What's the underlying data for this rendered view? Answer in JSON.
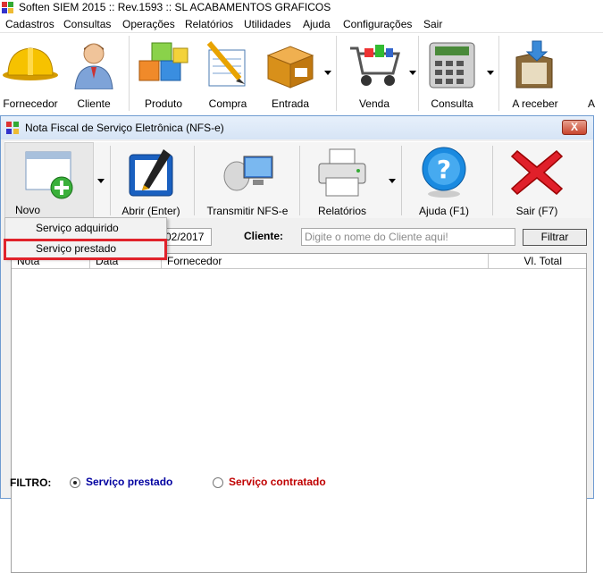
{
  "app": {
    "title": "Soften SIEM 2015 :: Rev.1593 :: SL ACABAMENTOS GRAFICOS"
  },
  "menubar": {
    "items": [
      "Cadastros",
      "Consultas",
      "Operações",
      "Relatórios",
      "Utilidades",
      "Ajuda",
      "Configurações",
      "Sair"
    ]
  },
  "main_toolbar": {
    "buttons": [
      "Fornecedor",
      "Cliente",
      "Produto",
      "Compra",
      "Entrada",
      "Venda",
      "Consulta",
      "A receber",
      "A"
    ]
  },
  "nfse_window": {
    "title": "Nota Fiscal de Serviço Eletrônica (NFS-e)",
    "close_label": "X",
    "toolbar": {
      "buttons": [
        "Novo",
        "Abrir (Enter)",
        "Transmitir NFS-e",
        "Relatórios",
        "Ajuda (F1)",
        "Sair (F7)"
      ]
    },
    "dropdown": {
      "items": [
        "Serviço adquirido",
        "Serviço prestado"
      ]
    },
    "filters": {
      "date_value": "02/2017",
      "cliente_label": "Cliente:",
      "cliente_placeholder": "Digite o nome do Cliente aqui!",
      "filtrar_label": "Filtrar"
    },
    "grid": {
      "columns": [
        "Nota",
        "Data",
        "Fornecedor",
        "Vl. Total"
      ]
    },
    "filtro": {
      "label": "FILTRO:",
      "options": [
        "Serviço prestado",
        "Serviço contratado"
      ],
      "selected": "Serviço prestado",
      "option_colors": [
        "#0000a0",
        "#c00000"
      ]
    }
  },
  "colors": {
    "highlight_border": "#e0232b",
    "window_border": "#6f9bd1"
  }
}
